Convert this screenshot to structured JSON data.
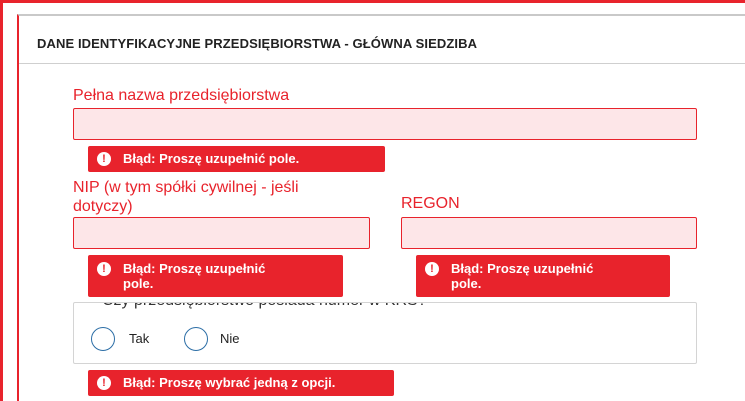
{
  "section": {
    "title": "DANE IDENTYFIKACYJNE PRZEDSIĘBIORSTWA - GŁÓWNA SIEDZIBA"
  },
  "fields": {
    "company_name": {
      "label": "Pełna nazwa przedsiębiorstwa",
      "value": ""
    },
    "nip": {
      "label_line1": "NIP (w tym spółki cywilnej - jeśli",
      "label_line2": "dotyczy)",
      "value": ""
    },
    "regon": {
      "label": "REGON",
      "value": ""
    }
  },
  "errors": {
    "company_name": "Błąd: Proszę uzupełnić pole.",
    "nip_line1": "Błąd: Proszę uzupełnić",
    "nip_line2": "pole.",
    "regon_line1": "Błąd: Proszę uzupełnić",
    "regon_line2": "pole.",
    "krs": "Błąd: Proszę wybrać jedną z opcji.",
    "icon_glyph": "!"
  },
  "krs": {
    "question": "Czy przedsiębiorstwo posiada numer w KRS?",
    "options": [
      {
        "label": "Tak",
        "selected": false
      },
      {
        "label": "Nie",
        "selected": false
      }
    ]
  },
  "colors": {
    "error_red": "#e8232c",
    "field_bg": "#fde6e8",
    "radio_border": "#2c6ea6"
  }
}
